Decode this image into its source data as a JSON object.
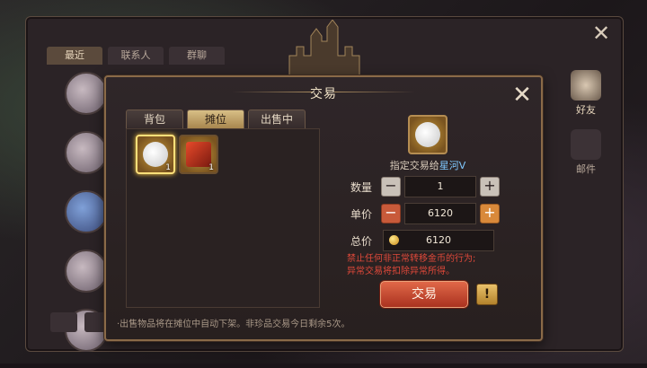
{
  "outer": {
    "tabs": [
      {
        "label": "最近",
        "active": true
      },
      {
        "label": "联系人",
        "active": false
      },
      {
        "label": "群聊",
        "active": false
      }
    ],
    "side_nav": [
      {
        "label": "好友",
        "icon": "friend-icon",
        "active": true
      },
      {
        "label": "邮件",
        "icon": "mail-icon",
        "active": false
      }
    ]
  },
  "dialog": {
    "title": "交易",
    "tabs": [
      {
        "label": "背包",
        "active": false
      },
      {
        "label": "摊位",
        "active": true
      },
      {
        "label": "出售中",
        "active": false
      }
    ],
    "inventory": [
      {
        "icon": "pet-egg-icon",
        "count": "1",
        "selected": true
      },
      {
        "icon": "treasure-book-icon",
        "count": "1",
        "selected": false
      }
    ],
    "hint": "·出售物品将在摊位中自动下架。非珍品交易今日剩余5次。",
    "recipient_prefix": "指定交易给",
    "recipient_name": "星河V",
    "quantity_label": "数量",
    "quantity_value": "1",
    "price_label": "单价",
    "price_value": "6120",
    "total_label": "总价",
    "total_value": "6120",
    "warning_line1": "禁止任何非正常转移金币的行为;",
    "warning_line2": "异常交易将扣除异常所得。",
    "trade_button": "交易",
    "info_button": "!",
    "colors": {
      "accent": "#d8bf86",
      "warning": "#e0493a",
      "recipient": "#7fc9ff"
    }
  }
}
